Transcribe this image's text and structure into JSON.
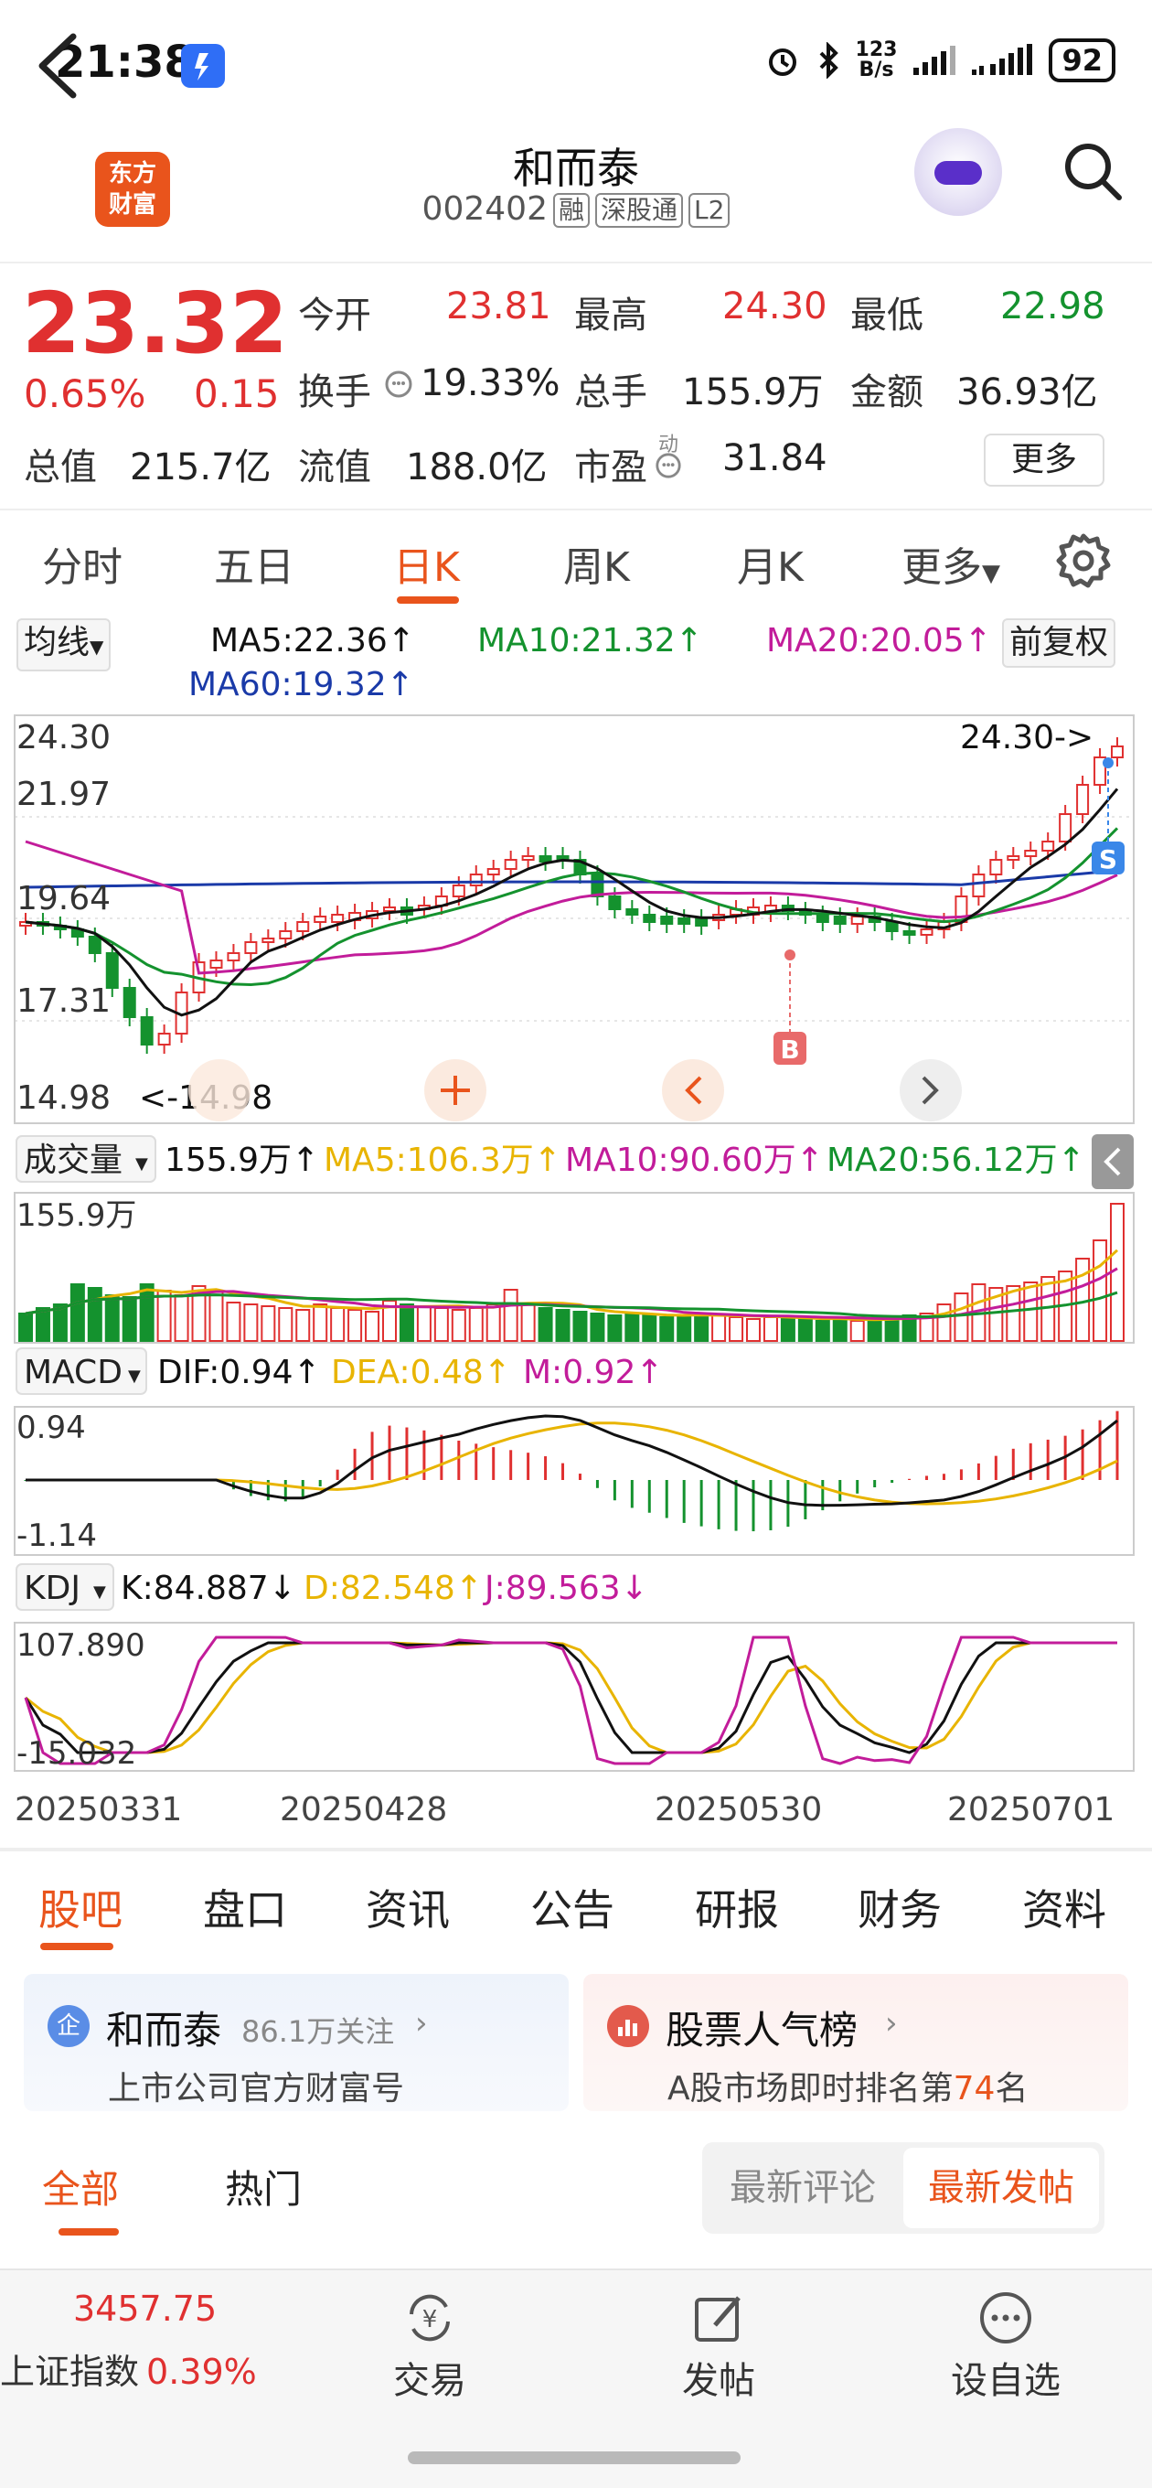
{
  "status_bar": {
    "time": "21:38",
    "net_speed_top": "123",
    "net_speed_bottom": "B/s",
    "battery": "92"
  },
  "header": {
    "logo_text": [
      "东方",
      "财富"
    ],
    "stock_name": "和而泰",
    "stock_code": "002402",
    "tags": [
      "融",
      "深股通",
      "L2"
    ]
  },
  "quote": {
    "price": "23.32",
    "change_pct": "0.65%",
    "change": "0.15",
    "fields": [
      {
        "label": "今开",
        "value": "23.81",
        "color": "#e03030"
      },
      {
        "label": "最高",
        "value": "24.30",
        "color": "#e03030"
      },
      {
        "label": "最低",
        "value": "22.98",
        "color": "#14922e"
      },
      {
        "label": "换手",
        "value": "19.33%",
        "color": "#222222"
      },
      {
        "label": "总手",
        "value": "155.9万",
        "color": "#222222"
      },
      {
        "label": "金额",
        "value": "36.93亿",
        "color": "#222222"
      },
      {
        "label": "总值",
        "value": "215.7亿",
        "color": "#222222"
      },
      {
        "label": "流值",
        "value": "188.0亿",
        "color": "#222222"
      },
      {
        "label": "市盈",
        "value": "31.84",
        "color": "#222222"
      }
    ],
    "pe_superscript": "动",
    "more_button": "更多"
  },
  "chart_tabs": {
    "items": [
      "分时",
      "五日",
      "日K",
      "周K",
      "月K",
      "更多"
    ],
    "active": "日K"
  },
  "ma_legend": {
    "selector": "均线",
    "ma5": "MA5:22.36↑",
    "ma10": "MA10:21.32↑",
    "ma20": "MA20:20.05↑",
    "ma60": "MA60:19.32↑",
    "adjust_button": "前复权",
    "colors": {
      "ma5": "#111111",
      "ma10": "#14922e",
      "ma20": "#c21c9a",
      "ma60": "#1a3aa8"
    }
  },
  "kline": {
    "y_labels": [
      "24.30",
      "21.97",
      "19.64",
      "17.31",
      "14.98"
    ],
    "high_label": "24.30->",
    "low_label": "<-14.98",
    "buy_marker": "B",
    "sell_marker": "S",
    "dates": [
      "20250331",
      "20250428",
      "20250530",
      "20250701"
    ]
  },
  "volume": {
    "selector": "成交量",
    "value": "155.9万↑",
    "ma5": "MA5:106.3万↑",
    "ma10": "MA10:90.60万↑",
    "ma20": "MA20:56.12万↑",
    "y_label": "155.9万",
    "colors": {
      "ma5": "#e8b400",
      "ma10": "#c21c9a",
      "ma20": "#14922e"
    }
  },
  "macd": {
    "selector": "MACD",
    "dif": "DIF:0.94↑",
    "dea": "DEA:0.48↑",
    "m": "M:0.92↑",
    "y_labels": [
      "0.94",
      "-1.14"
    ],
    "colors": {
      "dif": "#111111",
      "dea": "#e8b400",
      "m": "#c21c9a"
    }
  },
  "kdj": {
    "selector": "KDJ",
    "k": "K:84.887↓",
    "d": "D:82.548↑",
    "j": "J:89.563↓",
    "y_labels": [
      "107.890",
      "-15.032"
    ],
    "colors": {
      "k": "#111111",
      "d": "#e8b400",
      "j": "#c21c9a"
    }
  },
  "info_tabs": {
    "items": [
      "股吧",
      "盘口",
      "资讯",
      "公告",
      "研报",
      "财务",
      "资料"
    ],
    "active": "股吧"
  },
  "cards": {
    "company": {
      "badge": "企",
      "name": "和而泰",
      "followers": "86.1万关注",
      "sub": "上市公司官方财富号"
    },
    "ranking": {
      "title": "股票人气榜",
      "sub_prefix": "A股市场即时排名第",
      "rank": "74",
      "sub_suffix": "名"
    }
  },
  "feed_tabs": {
    "all": "全部",
    "hot": "热门",
    "latest_comment": "最新评论",
    "latest_post": "最新发帖"
  },
  "bottom_bar": {
    "index_value": "3457.75",
    "index_name": "上证指数",
    "index_change": "0.39%",
    "items": [
      {
        "label": "交易",
        "icon": "yuan-exchange-icon"
      },
      {
        "label": "发帖",
        "icon": "edit-icon"
      },
      {
        "label": "设自选",
        "icon": "more-dots-icon"
      }
    ]
  }
}
